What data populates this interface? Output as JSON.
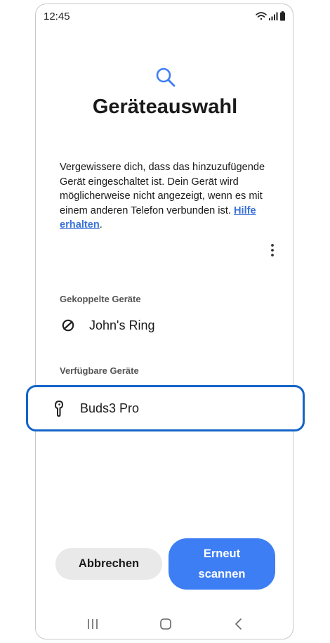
{
  "status_bar": {
    "time": "12:45",
    "icons": [
      "wifi-icon",
      "signal-icon",
      "battery-icon"
    ]
  },
  "header": {
    "icon": "search-icon",
    "title": "Geräteauswahl"
  },
  "description": {
    "text": "Vergewissere dich, dass das hinzuzufügende Gerät eingeschaltet ist. Dein Gerät wird möglicherweise nicht angezeigt, wenn es mit einem anderen Telefon verbunden ist.",
    "link_part1": "Hilfe",
    "link_part2": "erhalten",
    "suffix": "."
  },
  "more_icon": "more-vertical-icon",
  "paired": {
    "label": "Gekoppelte Geräte",
    "devices": [
      {
        "name": "John's Ring",
        "icon": "ring-icon"
      }
    ]
  },
  "available": {
    "label": "Verfügbare Geräte",
    "devices": [
      {
        "name": "Buds3 Pro",
        "icon": "earbud-icon"
      }
    ]
  },
  "buttons": {
    "cancel": "Abbrechen",
    "rescan_line1": "Erneut",
    "rescan_line2": "scannen"
  },
  "navigation": [
    "recent-apps-icon",
    "home-icon",
    "back-icon"
  ],
  "colors": {
    "accent": "#3d7ef5",
    "highlight_border": "#1464c8",
    "link": "#3a72d8"
  }
}
